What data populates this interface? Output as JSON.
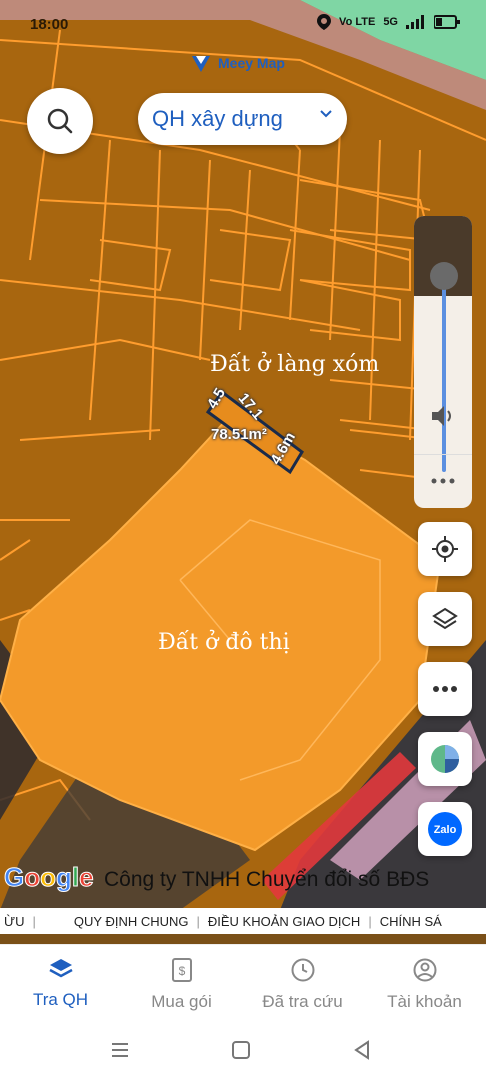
{
  "status_bar": {
    "time": "18:00",
    "network_label": "Vo LTE",
    "signal_label": "5G"
  },
  "brand": {
    "name": "Meey Map"
  },
  "layer_select": {
    "value": "QH xây dựng"
  },
  "map": {
    "zone_labels": [
      "Đất ở làng xóm",
      "Đất ở đô thị"
    ],
    "dimension_labels": [
      "4.5",
      "17.1",
      "78.51m²",
      "4.6m"
    ],
    "google_logo": "Google",
    "attribution": "Công ty TNHH Chuyển đổi số BĐS",
    "colors": {
      "dark_parcel": "#b06a12",
      "light_parcel": "#f39a2a",
      "parcel_line": "#ff9d2e"
    }
  },
  "controls": {
    "zoom_slider_icons": [
      "volume-icon",
      "more-icon"
    ],
    "buttons": [
      "locate-icon",
      "layers-icon",
      "more-icon",
      "pie-chart-icon",
      "zalo-icon"
    ],
    "zalo_label": "Zalo"
  },
  "ticker": {
    "items": [
      "ỪU",
      "QUY ĐỊNH CHUNG",
      "ĐIỀU KHOẢN GIAO DỊCH",
      "CHÍNH SÁ"
    ]
  },
  "tabs": [
    {
      "label": "Tra QH",
      "icon": "layers-icon",
      "active": true
    },
    {
      "label": "Mua gói",
      "icon": "receipt-icon",
      "active": false
    },
    {
      "label": "Đã tra cứu",
      "icon": "clock-icon",
      "active": false
    },
    {
      "label": "Tài khoản",
      "icon": "account-icon",
      "active": false
    }
  ],
  "accent_color": "#1f5fbf"
}
